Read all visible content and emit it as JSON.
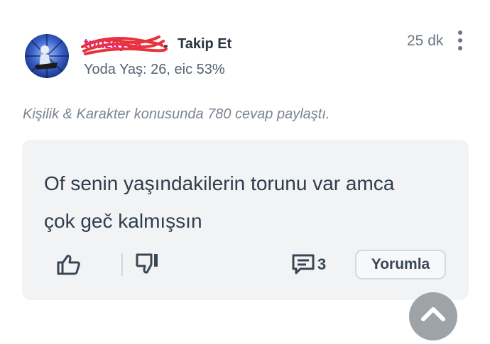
{
  "post": {
    "username": "tutizayca",
    "separator": "-",
    "follow_label": "Takip Et",
    "level": "Yoda",
    "stats": "Yaş: 26, eic 53%",
    "time": "25 dk",
    "activity": "Kişilik & Karakter konusunda 780 cevap paylaştı."
  },
  "answer": {
    "line1": "Of senin yaşındakilerin torunu var amca",
    "line2": "çok geč kalmışsın"
  },
  "actions": {
    "comment_count": "3",
    "reply_label": "Yorumla"
  },
  "icons": {
    "menu": "more-vertical-icon",
    "like": "thumbs-up-icon",
    "dislike": "thumbs-down-icon",
    "comment": "comment-icon",
    "scroll": "chevron-up-icon"
  },
  "colors": {
    "username": "#e11d8a",
    "scribble": "#e8323c",
    "card_bg": "#f1f3f5",
    "text": "#2f3d4c"
  }
}
